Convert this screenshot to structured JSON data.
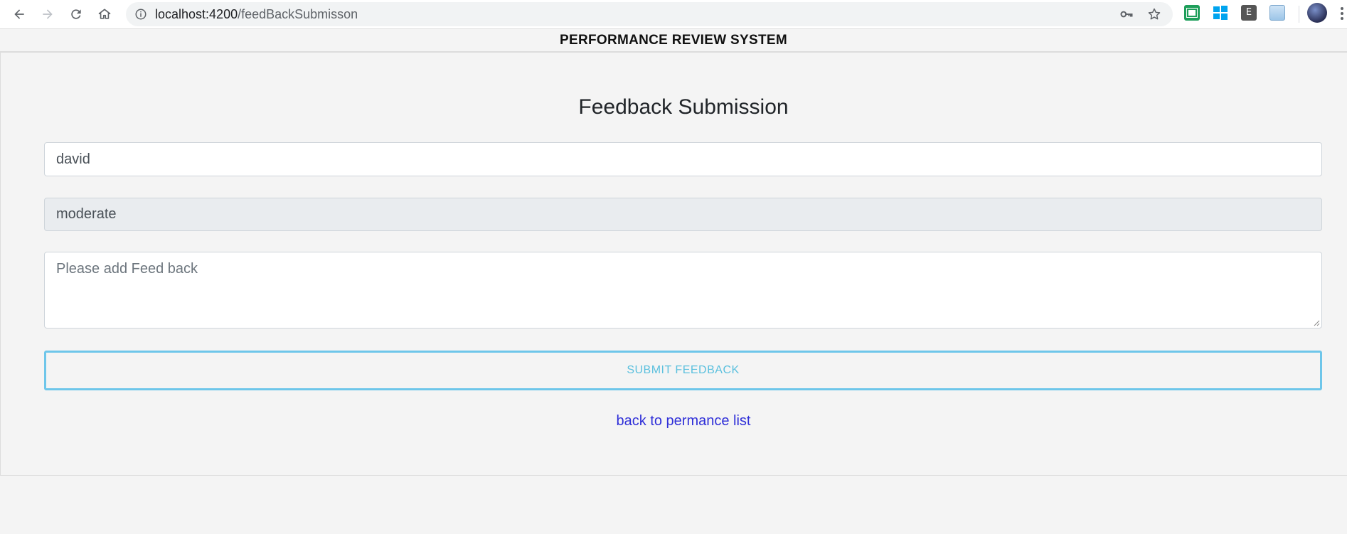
{
  "browser": {
    "url_host": "localhost:4200",
    "url_path": "/feedBackSubmisson"
  },
  "header": {
    "title": "PERFORMANCE REVIEW SYSTEM"
  },
  "form": {
    "title": "Feedback Submission",
    "employee_name": "david",
    "rating": "moderate",
    "feedback_placeholder": "Please add Feed back",
    "submit_label": "SUBMIT FEEDBACK",
    "back_link": "back to permance list"
  },
  "colors": {
    "submit_border": "#6ec6ea",
    "submit_text": "#5bc0de",
    "link": "#2f2fd8",
    "readonly_bg": "#e9ecef"
  },
  "icons": [
    "back-arrow-icon",
    "forward-arrow-icon",
    "reload-icon",
    "home-icon",
    "info-icon",
    "key-icon",
    "star-icon",
    "kebab-menu-icon"
  ]
}
